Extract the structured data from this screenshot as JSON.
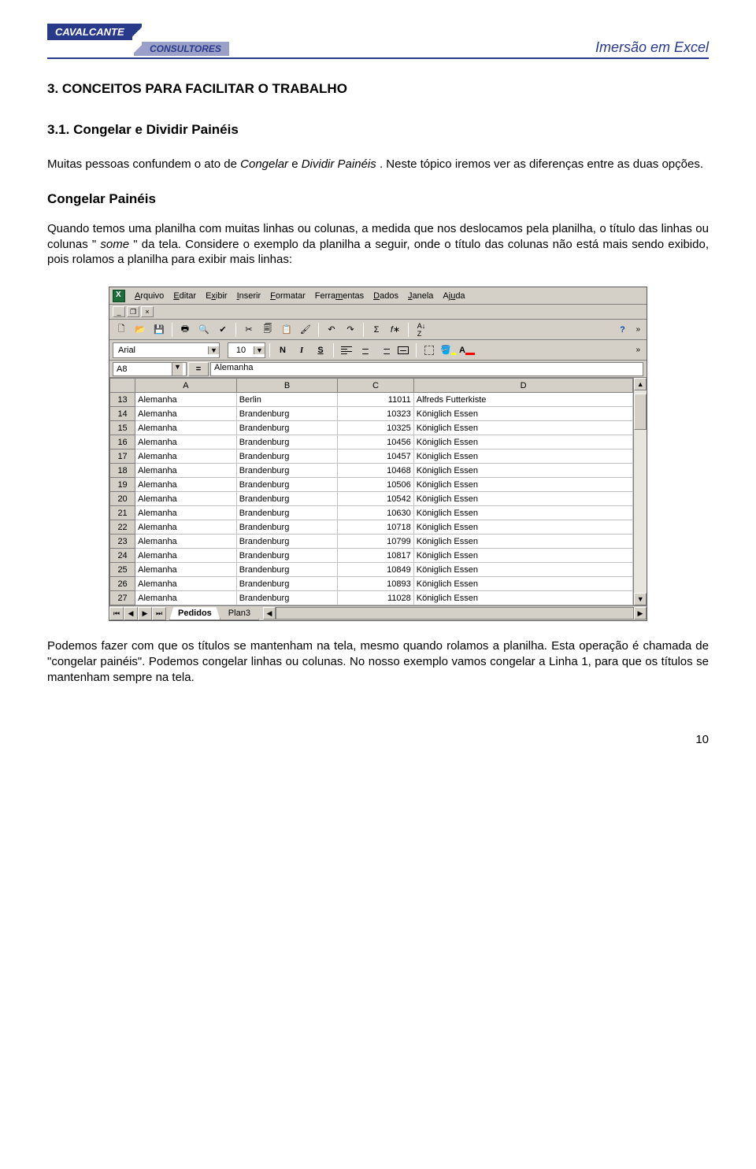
{
  "header": {
    "logo_top": "CAVALCANTE",
    "logo_bot": "CONSULTORES",
    "doc_title": "Imersão em Excel"
  },
  "section": {
    "h": "3.   CONCEITOS PARA FACILITAR O TRABALHO",
    "sub_h": "3.1.   Congelar e Dividir Painéis",
    "p1a": "Muitas pessoas confundem o ato de ",
    "p1_em1": "Congelar",
    "p1b": " e ",
    "p1_em2": "Dividir Painéis",
    "p1c": ". Neste tópico iremos ver as diferenças entre as duas opções.",
    "h2": "Congelar Painéis",
    "p2a": "Quando temos uma planilha com muitas linhas ou colunas, a medida que nos deslocamos pela planilha, o título das linhas ou colunas \" ",
    "p2_em": "some",
    "p2b": " \" da tela. Considere o exemplo da planilha a seguir, onde o título das colunas não está mais sendo exibido, pois rolamos a planilha para exibir mais linhas:",
    "p3": "Podemos fazer com que os títulos se mantenham na tela, mesmo quando rolamos a planilha. Esta operação é chamada de \"congelar painéis\".  Podemos congelar linhas ou colunas. No nosso exemplo vamos congelar a Linha 1, para que os títulos se mantenham sempre na tela."
  },
  "excel": {
    "menus": [
      "Arquivo",
      "Editar",
      "Exibir",
      "Inserir",
      "Formatar",
      "Ferramentas",
      "Dados",
      "Janela",
      "Ajuda"
    ],
    "menus_accel": [
      "A",
      "E",
      "x",
      "I",
      "F",
      "m",
      "D",
      "J",
      "u"
    ],
    "font_name": "Arial",
    "font_size": "10",
    "namebox": "A8",
    "formula_value": "Alemanha",
    "col_letters": [
      "A",
      "B",
      "C",
      "D"
    ],
    "rows": [
      {
        "n": "13",
        "a": "Alemanha",
        "b": "Berlin",
        "c": "11011",
        "d": "Alfreds Futterkiste"
      },
      {
        "n": "14",
        "a": "Alemanha",
        "b": "Brandenburg",
        "c": "10323",
        "d": "Königlich Essen"
      },
      {
        "n": "15",
        "a": "Alemanha",
        "b": "Brandenburg",
        "c": "10325",
        "d": "Königlich Essen"
      },
      {
        "n": "16",
        "a": "Alemanha",
        "b": "Brandenburg",
        "c": "10456",
        "d": "Königlich Essen"
      },
      {
        "n": "17",
        "a": "Alemanha",
        "b": "Brandenburg",
        "c": "10457",
        "d": "Königlich Essen"
      },
      {
        "n": "18",
        "a": "Alemanha",
        "b": "Brandenburg",
        "c": "10468",
        "d": "Königlich Essen"
      },
      {
        "n": "19",
        "a": "Alemanha",
        "b": "Brandenburg",
        "c": "10506",
        "d": "Königlich Essen"
      },
      {
        "n": "20",
        "a": "Alemanha",
        "b": "Brandenburg",
        "c": "10542",
        "d": "Königlich Essen"
      },
      {
        "n": "21",
        "a": "Alemanha",
        "b": "Brandenburg",
        "c": "10630",
        "d": "Königlich Essen"
      },
      {
        "n": "22",
        "a": "Alemanha",
        "b": "Brandenburg",
        "c": "10718",
        "d": "Königlich Essen"
      },
      {
        "n": "23",
        "a": "Alemanha",
        "b": "Brandenburg",
        "c": "10799",
        "d": "Königlich Essen"
      },
      {
        "n": "24",
        "a": "Alemanha",
        "b": "Brandenburg",
        "c": "10817",
        "d": "Königlich Essen"
      },
      {
        "n": "25",
        "a": "Alemanha",
        "b": "Brandenburg",
        "c": "10849",
        "d": "Königlich Essen"
      },
      {
        "n": "26",
        "a": "Alemanha",
        "b": "Brandenburg",
        "c": "10893",
        "d": "Königlich Essen"
      },
      {
        "n": "27",
        "a": "Alemanha",
        "b": "Brandenburg",
        "c": "11028",
        "d": "Königlich Essen"
      }
    ],
    "sheet_tabs": {
      "active": "Pedidos",
      "other": "Plan3"
    }
  },
  "page_number": "10"
}
